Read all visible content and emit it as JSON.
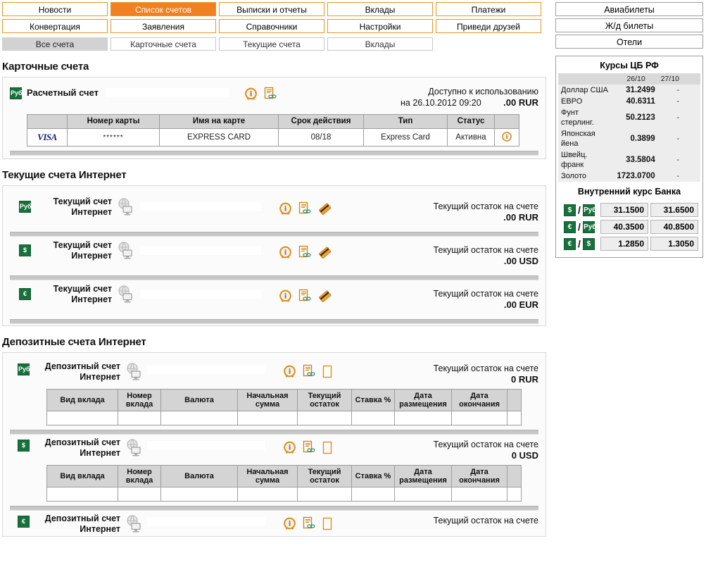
{
  "nav": {
    "items": [
      {
        "label": "Новости",
        "active": false
      },
      {
        "label": "Список счетов",
        "active": true
      },
      {
        "label": "Выписки и отчеты",
        "active": false
      },
      {
        "label": "Вклады",
        "active": false
      },
      {
        "label": "Платежи",
        "active": false
      },
      {
        "label": "Конвертация",
        "active": false
      },
      {
        "label": "Заявления",
        "active": false
      },
      {
        "label": "Справочники",
        "active": false
      },
      {
        "label": "Настройки",
        "active": false
      },
      {
        "label": "Приведи друзей",
        "active": false
      }
    ],
    "accent_color": "#f38020",
    "border_color": "#e8971f"
  },
  "subtabs": [
    {
      "label": "Все счета",
      "active": true
    },
    {
      "label": "Карточные счета",
      "active": false
    },
    {
      "label": "Текущие счета",
      "active": false
    },
    {
      "label": "Вклады",
      "active": false
    }
  ],
  "sections": {
    "card_accounts": {
      "title": "Карточные счета",
      "account": {
        "currency_icon": "Руб",
        "name": "Расчетный счет",
        "balance_label": "Доступно к использованию",
        "balance_date": "на 26.10.2012 09:20",
        "balance_amount": ".00 RUR"
      },
      "table": {
        "headers": [
          "",
          "Номер карты",
          "Имя на карте",
          "Срок действия",
          "Тип",
          "Статус",
          ""
        ],
        "row": {
          "brand": "VISA",
          "card_number": "******",
          "name_on_card": "EXPRESS CARD",
          "expiry": "08/18",
          "type": "Express Card",
          "status": "Активна",
          "status_color": "#0a8a2a"
        }
      }
    },
    "current_accounts": {
      "title": "Текущие счета Интернет",
      "balance_label": "Текущий остаток на счете",
      "rows": [
        {
          "currency_icon": "Руб",
          "name_line1": "Текущий счет",
          "name_line2": "Интернет",
          "amount": ".00 RUR"
        },
        {
          "currency_icon": "$",
          "name_line1": "Текущий счет",
          "name_line2": "Интернет",
          "amount": ".00 USD"
        },
        {
          "currency_icon": "€",
          "name_line1": "Текущий счет",
          "name_line2": "Интернет",
          "amount": ".00 EUR"
        }
      ]
    },
    "deposit_accounts": {
      "title": "Депозитные счета Интернет",
      "balance_label": "Текущий остаток на счете",
      "table_headers": [
        "Вид вклада",
        "Номер вклада",
        "Валюта",
        "Начальная сумма",
        "Текущий остаток",
        "Ставка %",
        "Дата размещения",
        "Дата окончания",
        ""
      ],
      "rows": [
        {
          "currency_icon": "Руб",
          "name_line1": "Депозитный счет",
          "name_line2": "Интернет",
          "amount": "0 RUR"
        },
        {
          "currency_icon": "$",
          "name_line1": "Депозитный счет",
          "name_line2": "Интернет",
          "amount": "0 USD"
        },
        {
          "currency_icon": "€",
          "name_line1": "Депозитный счет",
          "name_line2": "Интернет",
          "amount": ""
        }
      ]
    }
  },
  "sidebar": {
    "buttons": [
      {
        "label": "Авиабилеты"
      },
      {
        "label": "Ж/д билеты"
      },
      {
        "label": "Отели"
      }
    ],
    "cbr": {
      "title": "Курсы ЦБ РФ",
      "col1": "26/10",
      "col2": "27/10",
      "rows": [
        {
          "name": "Доллар США",
          "v1": "31.2499",
          "v2": "-"
        },
        {
          "name": "ЕВРО",
          "v1": "40.6311",
          "v2": "-"
        },
        {
          "name": "Фунт стерлинг.",
          "v1": "50.2123",
          "v2": "-"
        },
        {
          "name": "Японская йена",
          "v1": "0.3899",
          "v2": "-"
        },
        {
          "name": "Швейц. франк",
          "v1": "33.5804",
          "v2": "-"
        },
        {
          "name": "Золото",
          "v1": "1723.0700",
          "v2": "-"
        }
      ]
    },
    "internal": {
      "title": "Внутренний курс Банка",
      "rows": [
        {
          "from": "$",
          "to": "Руб",
          "buy": "31.1500",
          "sell": "31.6500"
        },
        {
          "from": "€",
          "to": "Руб",
          "buy": "40.3500",
          "sell": "40.8500"
        },
        {
          "from": "€",
          "to": "$",
          "buy": "1.2850",
          "sell": "1.3050"
        }
      ]
    }
  }
}
